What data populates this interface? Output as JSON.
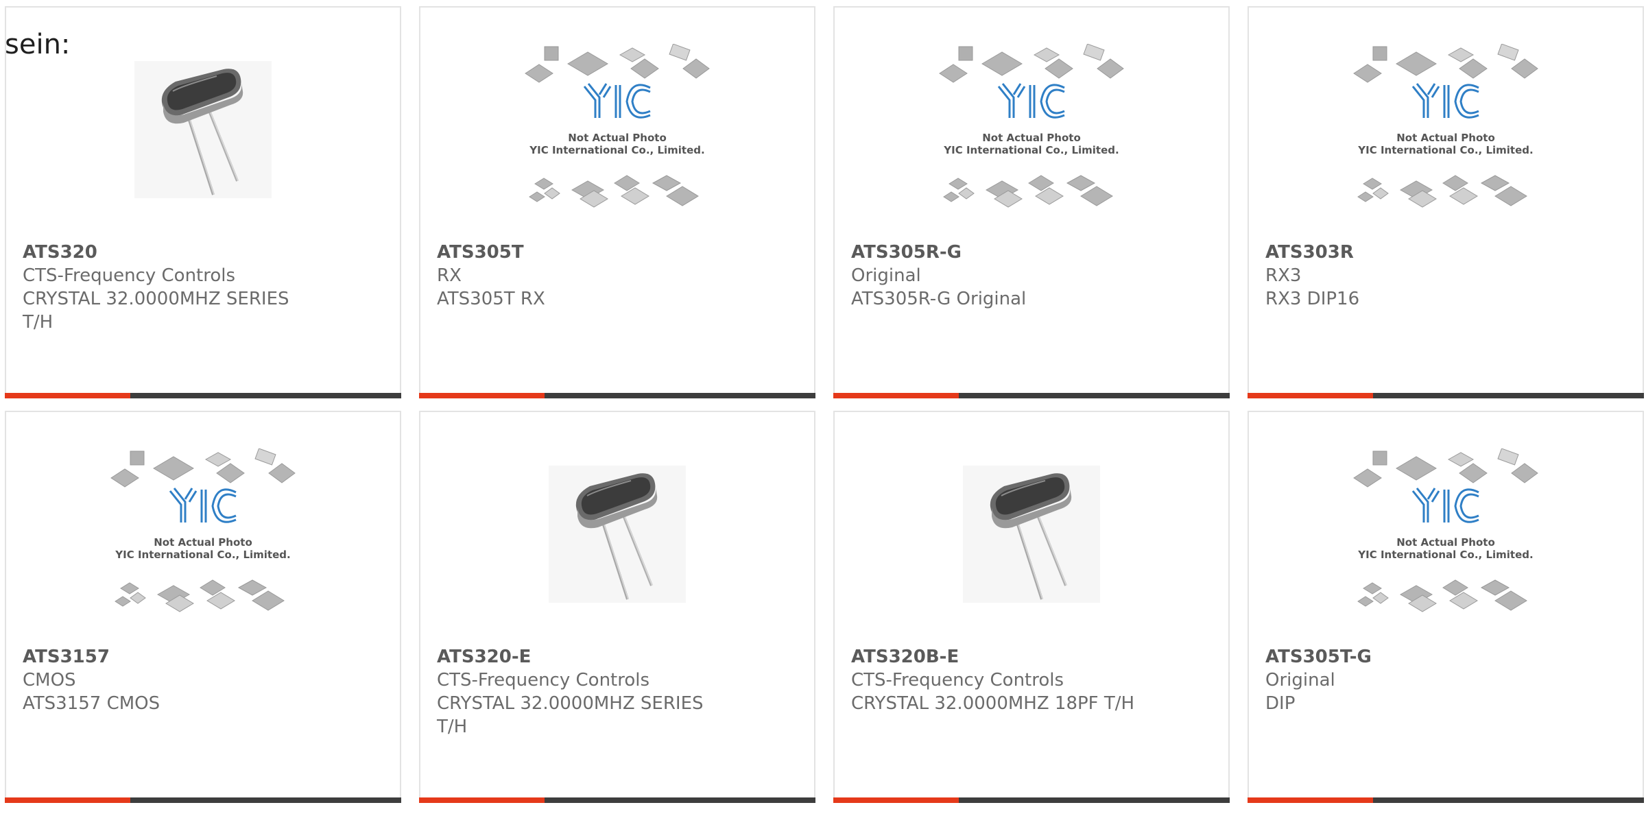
{
  "heading": "sein:",
  "products": [
    {
      "part_number": "ATS320",
      "line1": "CTS-Frequency Controls",
      "line2": "CRYSTAL 32.0000MHZ SERIES",
      "line3": "T/H",
      "image": "crystal-photo"
    },
    {
      "part_number": "ATS305T",
      "line1": "RX",
      "line2": "ATS305T RX",
      "line3": "",
      "image": "yic-placeholder"
    },
    {
      "part_number": "ATS305R-G",
      "line1": "Original",
      "line2": "ATS305R-G Original",
      "line3": "",
      "image": "yic-placeholder"
    },
    {
      "part_number": "ATS303R",
      "line1": "RX3",
      "line2": "RX3 DIP16",
      "line3": "",
      "image": "yic-placeholder"
    },
    {
      "part_number": "ATS3157",
      "line1": "CMOS",
      "line2": "ATS3157 CMOS",
      "line3": "",
      "image": "yic-placeholder"
    },
    {
      "part_number": "ATS320-E",
      "line1": "CTS-Frequency Controls",
      "line2": "CRYSTAL 32.0000MHZ SERIES",
      "line3": "T/H",
      "image": "crystal-photo"
    },
    {
      "part_number": "ATS320B-E",
      "line1": "CTS-Frequency Controls",
      "line2": "CRYSTAL 32.0000MHZ 18PF T/H",
      "line3": "",
      "image": "crystal-photo"
    },
    {
      "part_number": "ATS305T-G",
      "line1": "Original",
      "line2": "DIP",
      "line3": "",
      "image": "yic-placeholder"
    }
  ],
  "placeholder": {
    "caption1": "Not Actual Photo",
    "caption2": "YIC International Co., Limited."
  },
  "colors": {
    "accent": "#e5391a",
    "bar": "#3d3d3d",
    "border": "#e3e3e3",
    "text": "#6b6b6b"
  }
}
